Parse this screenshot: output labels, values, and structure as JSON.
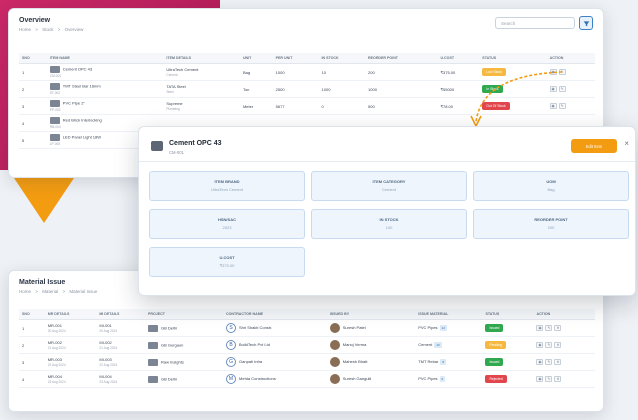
{
  "overview": {
    "title": "Overview",
    "breadcrumb": [
      "Home",
      ">",
      "Stock",
      ">",
      "Overview"
    ],
    "search_placeholder": "Search",
    "columns": [
      "Sno",
      "Item Name",
      "Item Details",
      "Unit",
      "Per Unit",
      "In Stock",
      "Reorder Point",
      "U.Cost",
      "Status",
      "Action"
    ],
    "rows": [
      {
        "sno": "1",
        "name": "Cement OPC 43",
        "name_sub": "CM-001",
        "details": "UltraTech Cement",
        "details_sub": "Cement",
        "unit": "Bag",
        "per_unit": "1000",
        "stock": "10",
        "reorder": "200",
        "cost": "₹375.00",
        "status": "Low Stock"
      },
      {
        "sno": "2",
        "name": "TMT Steel Bar 16mm",
        "name_sub": "ST-002",
        "details": "TATA Steel",
        "details_sub": "Steel",
        "unit": "Ton",
        "per_unit": "2500",
        "stock": "1000",
        "reorder": "1000",
        "cost": "₹55000",
        "status": "In Stock"
      },
      {
        "sno": "3",
        "name": "PVC Pipe 2\"",
        "name_sub": "PP-003",
        "details": "Supreme",
        "details_sub": "Plumbing",
        "unit": "Meter",
        "per_unit": "5677",
        "stock": "0",
        "reorder": "500",
        "cost": "₹78.00",
        "status": "Out Of Stock"
      },
      {
        "sno": "4",
        "name": "Red Brick Interlocking",
        "name_sub": "RB-004",
        "details": "",
        "details_sub": "",
        "unit": "",
        "per_unit": "",
        "stock": "",
        "reorder": "",
        "cost": "",
        "status": ""
      },
      {
        "sno": "5",
        "name": "LED Panel Light 18W",
        "name_sub": "LP-005",
        "details": "",
        "details_sub": "",
        "unit": "",
        "per_unit": "",
        "stock": "",
        "reorder": "",
        "cost": "",
        "status": ""
      }
    ]
  },
  "modal": {
    "title": "Cement OPC 43",
    "subtitle": "CM-001",
    "edit_label": "Edit Item",
    "close_glyph": "×",
    "cards": [
      {
        "label": "Item Brand",
        "value": "UltraTech Cement"
      },
      {
        "label": "Item Category",
        "value": "Cement"
      },
      {
        "label": "UOM",
        "value": "Bag"
      },
      {
        "label": "HSN/SAC",
        "value": "2523"
      },
      {
        "label": "In Stock",
        "value": "100"
      },
      {
        "label": "Reorder Point",
        "value": "200"
      },
      {
        "label": "U.Cost",
        "value": "₹375.00"
      }
    ]
  },
  "issue": {
    "title": "Material Issue",
    "breadcrumb": [
      "Home",
      ">",
      "Material",
      ">",
      "Material Issue"
    ],
    "columns": [
      "Sno",
      "MR Details",
      "MI Details",
      "Project",
      "Contractor Name",
      "Issued By",
      "Issue Material",
      "Status",
      "Action"
    ],
    "rows": [
      {
        "sno": "1",
        "mr": "MR-001",
        "mr_sub": "20 Aug 2024",
        "mi": "MI-001",
        "mi_sub": "20 Aug 2024",
        "project": "GB Delhi",
        "contractor": "Shri Shakti Constr.",
        "issued_by": "Suresh Patel",
        "material": "PVC Pipes",
        "material_count": "12",
        "status": "Issued"
      },
      {
        "sno": "2",
        "mr": "MR-002",
        "mr_sub": "21 Aug 2024",
        "mi": "MI-002",
        "mi_sub": "21 Aug 2024",
        "project": "GB Gurgaon",
        "contractor": "BuildTech Pvt Ltd",
        "issued_by": "Manoj Verma",
        "material": "Cement",
        "material_count": "10",
        "status": "Pending"
      },
      {
        "sno": "3",
        "mr": "MR-003",
        "mr_sub": "22 Aug 2024",
        "mi": "MI-003",
        "mi_sub": "22 Aug 2024",
        "project": "Raw Insights",
        "contractor": "Ganpati Infra",
        "issued_by": "Mahesh Bhatt",
        "material": "TMT Rebar",
        "material_count": "8",
        "status": "Issued"
      },
      {
        "sno": "4",
        "mr": "MR-004",
        "mr_sub": "23 Aug 2024",
        "mi": "MI-004",
        "mi_sub": "23 Aug 2024",
        "project": "GB Delhi",
        "contractor": "Mehta Constructions",
        "issued_by": "Suresh Gangulli",
        "material": "PVC Pipes",
        "material_count": "6",
        "status": "Rejected"
      }
    ]
  },
  "colors": {
    "accent": "#f39c12",
    "brand": "#d12b6b",
    "primary": "#2f6fb0",
    "success": "#2fa84f",
    "danger": "#e1464d",
    "warning": "#f5b942"
  },
  "icons": {
    "search": "search-icon",
    "filter": "filter-icon",
    "close": "close-icon",
    "view": "eye-icon",
    "edit": "pencil-icon"
  }
}
